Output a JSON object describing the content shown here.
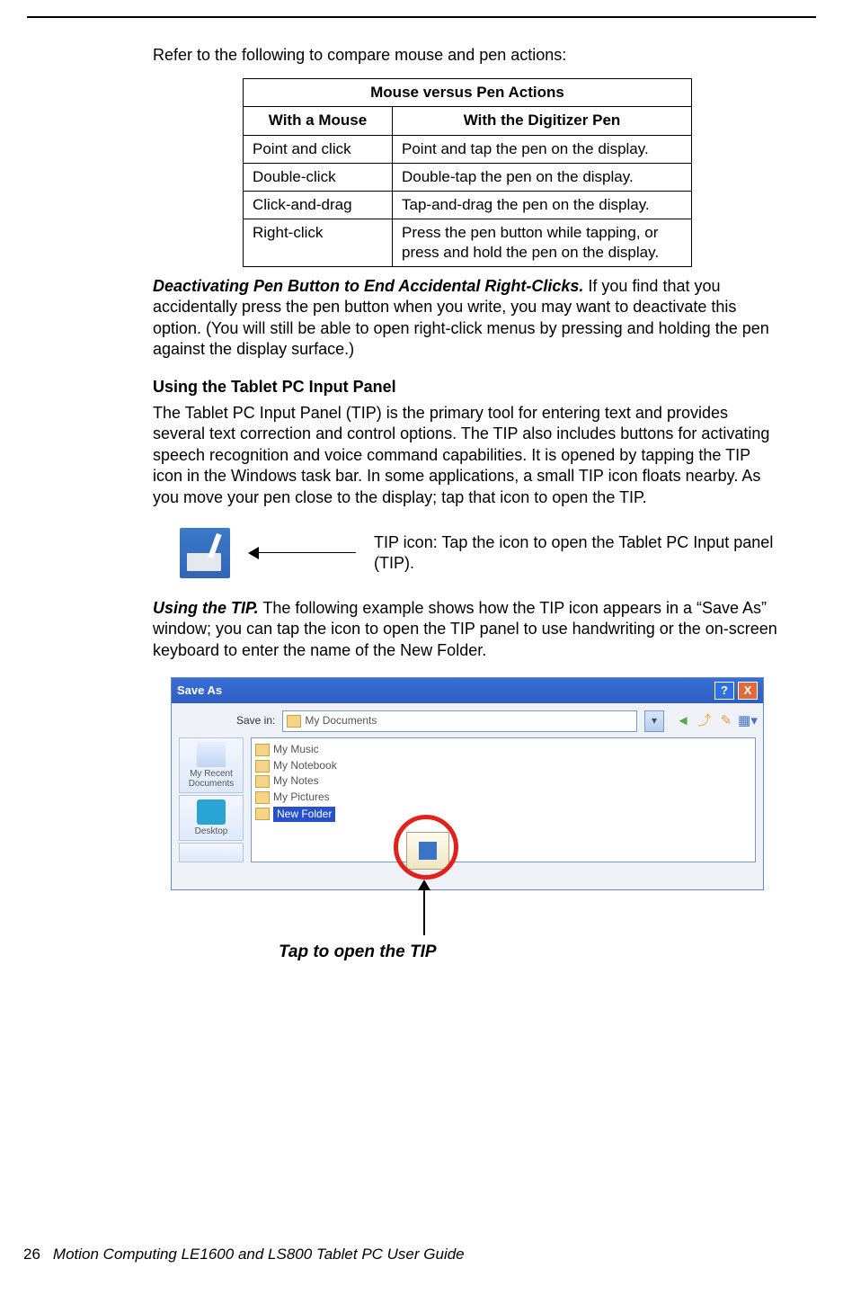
{
  "intro": "Refer to the following to compare mouse and pen actions:",
  "table": {
    "headerTop": "Mouse versus Pen Actions",
    "col1": "With a Mouse",
    "col2": "With the Digitizer Pen",
    "rows": [
      {
        "mouse": "Point and click",
        "pen": "Point and tap the pen on the display."
      },
      {
        "mouse": "Double-click",
        "pen": "Double-tap the pen on the display."
      },
      {
        "mouse": "Click-and-drag",
        "pen": "Tap-and-drag the pen on the display."
      },
      {
        "mouse": "Right-click",
        "pen": "Press the pen button while tapping, or press and hold the pen on the display."
      }
    ]
  },
  "deactivating": {
    "lead": "Deactivating Pen Button to End Accidental Right-Clicks.",
    "body": " If you find that you accidentally press the pen button when you write, you may want to deactivate this option. (You will still be able to open right-click menus by pressing and holding the pen against the display surface.)"
  },
  "tipHeading": "Using the Tablet PC Input Panel",
  "tipPara": "The Tablet PC Input Panel (TIP) is the primary tool for entering text and provides several text correction and control options. The TIP also includes buttons for activating speech recognition and voice command capabilities. It is opened by tapping the TIP icon in the Windows task bar. In some applications, a small TIP icon floats nearby. As you move your pen close to the display; tap that icon to open the TIP.",
  "tipIconLabel": "TIP icon: Tap the icon to open the Tablet PC Input panel (TIP).",
  "usingTip": {
    "lead": "Using the TIP.",
    "body": " The following example shows how the TIP icon appears in a “Save As” window; you can tap the icon to open the TIP panel to use handwriting or the on-screen keyboard to enter the name of the New Folder."
  },
  "saveAs": {
    "title": "Save As",
    "helpBtn": "?",
    "closeBtn": "X",
    "saveInLabel": "Save in:",
    "saveInValue": "My Documents",
    "places": {
      "recent": "My Recent Documents",
      "desktop": "Desktop"
    },
    "files": [
      "My Music",
      "My Notebook",
      "My Notes",
      "My Pictures"
    ],
    "newFolder": "New Folder"
  },
  "tapCaption": "Tap to open the TIP",
  "footer": {
    "pageNum": "26",
    "bookTitle": "Motion Computing LE1600 and LS800 Tablet PC User Guide"
  }
}
